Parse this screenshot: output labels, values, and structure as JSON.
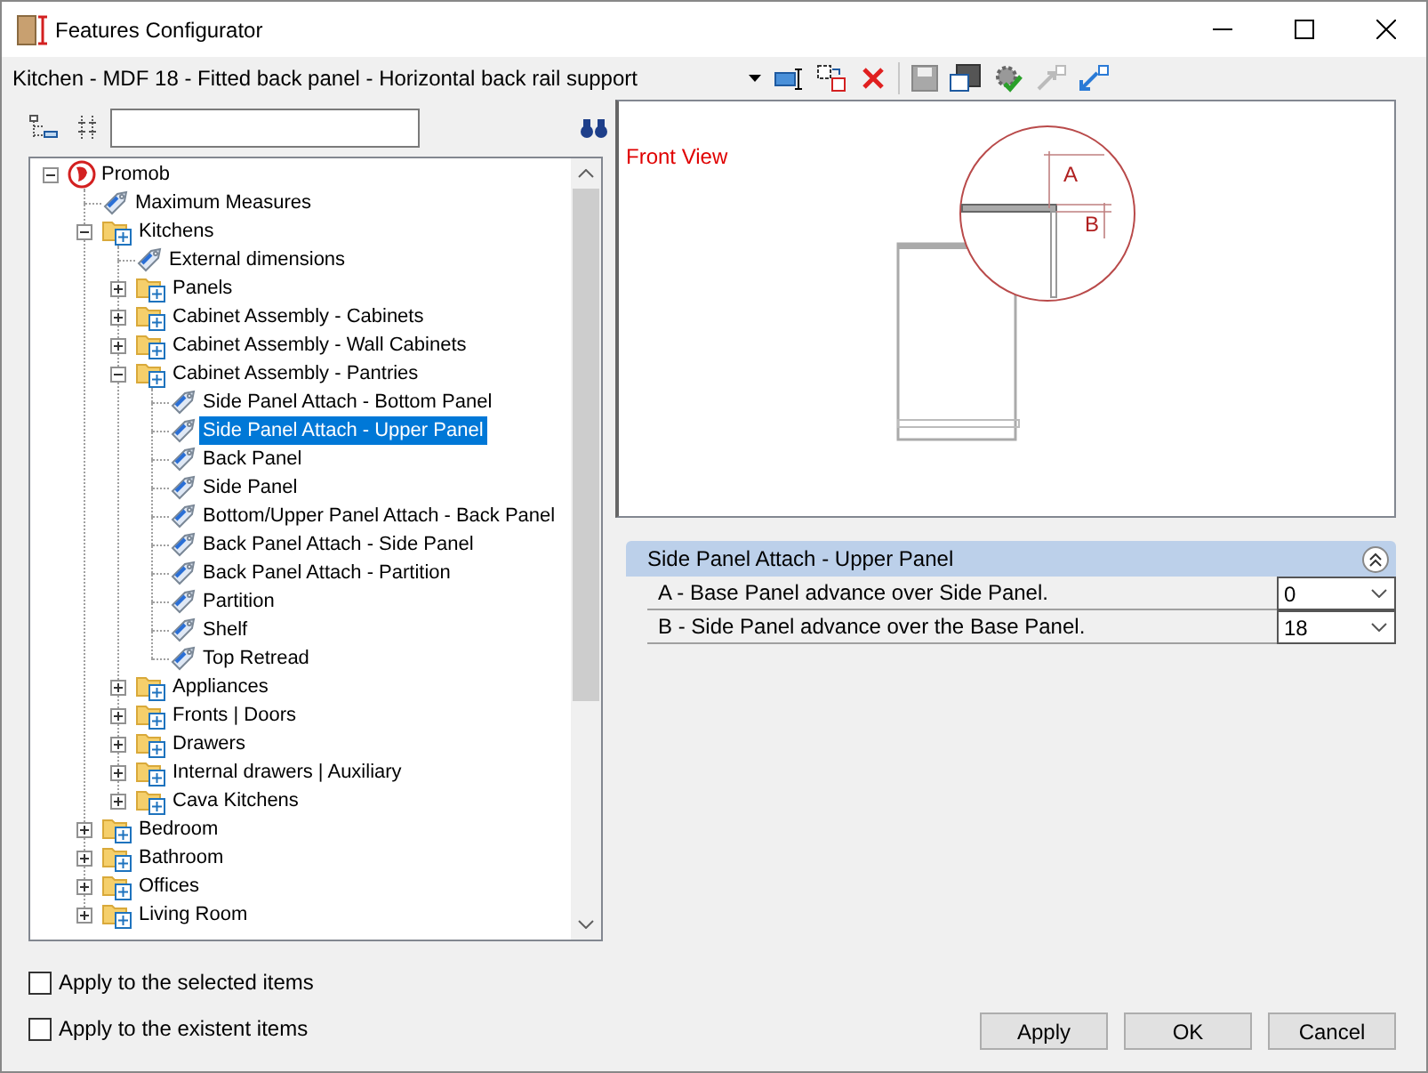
{
  "window": {
    "title": "Features Configurator"
  },
  "toolbar": {
    "configuration": "Kitchen - MDF 18 - Fitted back panel - Horizontal back rail support"
  },
  "tree": [
    {
      "label": "Promob",
      "kind": "root",
      "expanded": true,
      "selected": false,
      "children": [
        {
          "label": "Maximum Measures",
          "kind": "leaf",
          "selected": false
        },
        {
          "label": "Kitchens",
          "kind": "folder",
          "expanded": true,
          "selected": false,
          "children": [
            {
              "label": "External dimensions",
              "kind": "leaf",
              "selected": false
            },
            {
              "label": "Panels",
              "kind": "folder",
              "expanded": false,
              "selected": false
            },
            {
              "label": "Cabinet Assembly - Cabinets",
              "kind": "folder",
              "expanded": false,
              "selected": false
            },
            {
              "label": "Cabinet Assembly - Wall Cabinets",
              "kind": "folder",
              "expanded": false,
              "selected": false
            },
            {
              "label": "Cabinet Assembly - Pantries",
              "kind": "folder",
              "expanded": true,
              "selected": false,
              "children": [
                {
                  "label": "Side Panel Attach - Bottom Panel",
                  "kind": "leaf",
                  "selected": false
                },
                {
                  "label": "Side Panel Attach - Upper Panel",
                  "kind": "leaf",
                  "selected": true
                },
                {
                  "label": "Back Panel",
                  "kind": "leaf",
                  "selected": false
                },
                {
                  "label": "Side Panel",
                  "kind": "leaf",
                  "selected": false
                },
                {
                  "label": "Bottom/Upper Panel Attach - Back Panel",
                  "kind": "leaf",
                  "selected": false
                },
                {
                  "label": "Back Panel Attach - Side Panel",
                  "kind": "leaf",
                  "selected": false
                },
                {
                  "label": "Back Panel Attach - Partition",
                  "kind": "leaf",
                  "selected": false
                },
                {
                  "label": "Partition",
                  "kind": "leaf",
                  "selected": false
                },
                {
                  "label": "Shelf",
                  "kind": "leaf",
                  "selected": false
                },
                {
                  "label": "Top Retread",
                  "kind": "leaf",
                  "selected": false
                }
              ]
            },
            {
              "label": "Appliances",
              "kind": "folder",
              "expanded": false,
              "selected": false
            },
            {
              "label": "Fronts | Doors",
              "kind": "folder",
              "expanded": false,
              "selected": false
            },
            {
              "label": "Drawers",
              "kind": "folder",
              "expanded": false,
              "selected": false
            },
            {
              "label": "Internal drawers | Auxiliary",
              "kind": "folder",
              "expanded": false,
              "selected": false
            },
            {
              "label": "Cava Kitchens",
              "kind": "folder",
              "expanded": false,
              "selected": false
            }
          ]
        },
        {
          "label": "Bedroom",
          "kind": "folder",
          "expanded": false,
          "selected": false
        },
        {
          "label": "Bathroom",
          "kind": "folder",
          "expanded": false,
          "selected": false
        },
        {
          "label": "Offices",
          "kind": "folder",
          "expanded": false,
          "selected": false
        },
        {
          "label": "Living Room",
          "kind": "folder",
          "expanded": false,
          "selected": false
        }
      ]
    }
  ],
  "preview": {
    "title": "Front View",
    "labels": [
      "A",
      "B"
    ]
  },
  "properties": {
    "title": "Side Panel Attach - Upper Panel",
    "expanded": true,
    "rows": [
      {
        "label": "A - Base Panel advance over Side Panel.",
        "value": "0"
      },
      {
        "label": "B - Side Panel advance over the Base Panel.",
        "value": "18"
      }
    ]
  },
  "options": [
    {
      "label": "Apply to the selected items",
      "checked": false
    },
    {
      "label": "Apply to the existent items",
      "checked": false
    }
  ],
  "buttons": [
    "Apply",
    "OK",
    "Cancel"
  ]
}
